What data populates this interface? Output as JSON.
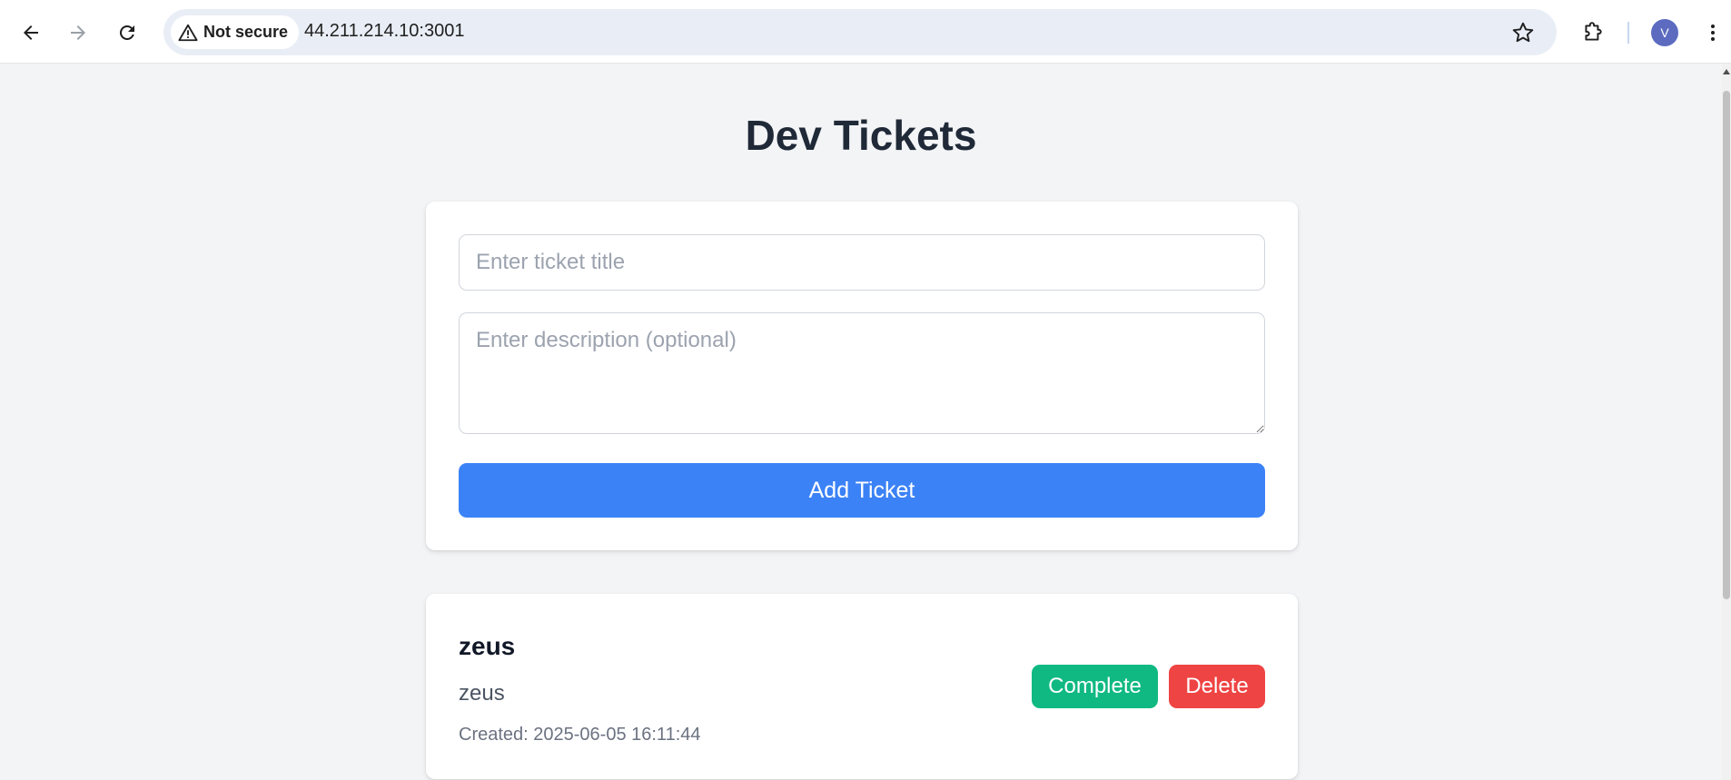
{
  "browser": {
    "security_label": "Not secure",
    "url": "44.211.214.10:3001",
    "profile_initial": "V",
    "icons": {
      "back": "arrow-left-icon",
      "forward": "arrow-right-icon",
      "reload": "reload-icon",
      "warning": "warning-triangle-icon",
      "bookmark": "star-icon",
      "extensions": "puzzle-icon",
      "menu": "kebab-menu-icon"
    }
  },
  "page": {
    "title": "Dev Tickets"
  },
  "form": {
    "title_placeholder": "Enter ticket title",
    "title_value": "",
    "description_placeholder": "Enter description (optional)",
    "description_value": "",
    "submit_label": "Add Ticket"
  },
  "tickets": [
    {
      "title": "zeus",
      "description": "zeus",
      "created": "Created: 2025-06-05 16:11:44",
      "complete_label": "Complete",
      "delete_label": "Delete"
    }
  ],
  "colors": {
    "background": "#f3f4f6",
    "primary": "#3b82f6",
    "success": "#10b981",
    "danger": "#ef4444",
    "avatar": "#5c6bc0"
  }
}
